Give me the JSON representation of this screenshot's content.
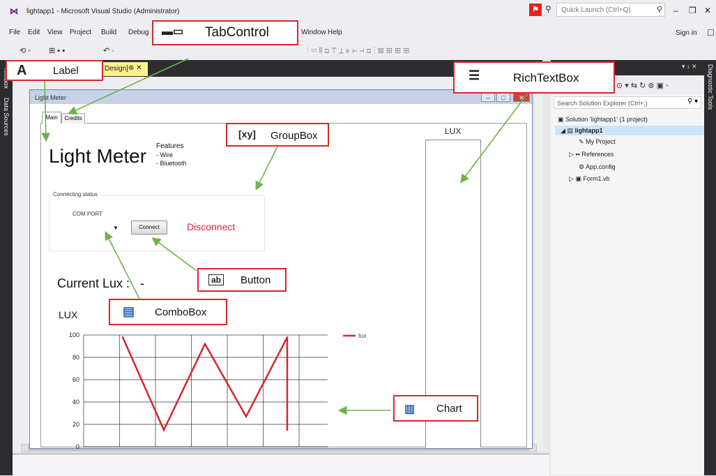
{
  "window": {
    "title": "lightapp1 - Microsoft Visual Studio (Administrator)",
    "quick_launch_placeholder": "Quick Launch (Ctrl+Q)",
    "sign_in": "Sign in"
  },
  "menu": [
    "File",
    "Edit",
    "View",
    "Project",
    "Build",
    "Debug",
    "Window",
    "Help"
  ],
  "left_strip": [
    "Toolbox",
    "Data Sources"
  ],
  "document_tab": {
    "label": "Design]",
    "pin": "⊕",
    "close": "✕"
  },
  "form": {
    "title": "Light Meter",
    "tabs": [
      "Main",
      "Credits"
    ],
    "heading": "Light Meter",
    "features_title": "Features",
    "features": [
      "- Wire",
      "- Bluetooth"
    ],
    "groupbox_label": "Connecting status",
    "com_port_label": "COM PORT",
    "connect_button": "Connect",
    "disconnect_label": "Disconnect",
    "current_lux_label": "Current Lux :",
    "current_lux_value": "-",
    "richtextbox_label": "LUX"
  },
  "chart_data": {
    "type": "line",
    "title": "LUX",
    "ylim": [
      0,
      100
    ],
    "y_ticks": [
      0,
      20,
      40,
      60,
      80,
      100
    ],
    "x": [
      0,
      1,
      2,
      3,
      4,
      4
    ],
    "series": [
      {
        "name": "lux",
        "color": "#d4252f",
        "values": [
          98,
          15,
          92,
          27,
          98,
          15
        ]
      }
    ],
    "legend": "top-right",
    "grid": true
  },
  "solution_explorer": {
    "header": "▾ ↕ ✕",
    "search_placeholder": "Search Solution Explorer (Ctrl+;)",
    "items": [
      {
        "label": "Solution 'lightapp1' (1 project)",
        "icon": "solution-icon"
      },
      {
        "label": "lightapp1",
        "icon": "vb-project-icon"
      },
      {
        "label": "My Project",
        "icon": "wrench-icon"
      },
      {
        "label": "References",
        "icon": "references-icon"
      },
      {
        "label": "App.config",
        "icon": "config-icon"
      },
      {
        "label": "Form1.vb",
        "icon": "form-icon"
      }
    ]
  },
  "right_strip": "Diagnostic Tools",
  "annotations": {
    "tabcontrol": "TabControl",
    "label": "Label",
    "richtextbox": "RichTextBox",
    "groupbox": "GroupBox",
    "button": "Button",
    "combobox": "ComboBox",
    "chart": "Chart"
  },
  "annotation_color": "#d9262c",
  "arrow_color": "#6fb24a"
}
